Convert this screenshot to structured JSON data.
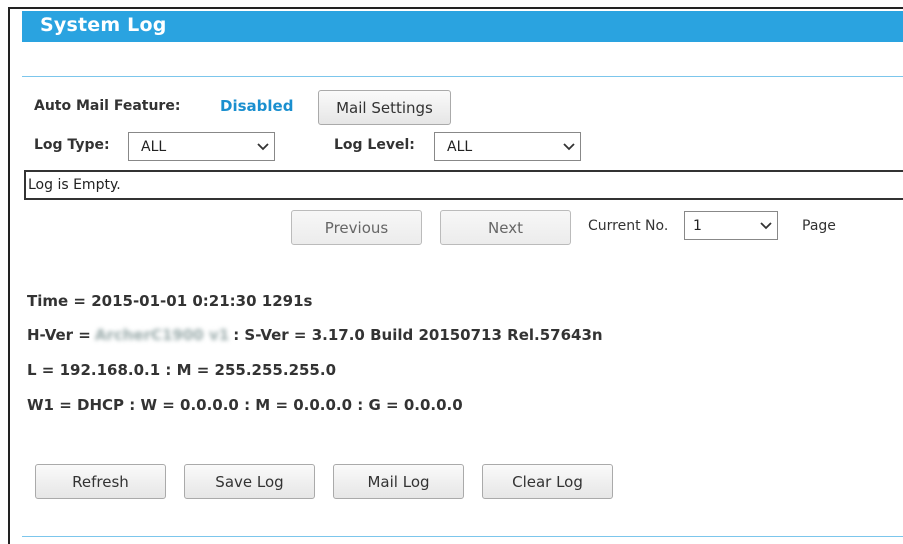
{
  "header": {
    "title": "System Log"
  },
  "controls": {
    "auto_mail_label": "Auto Mail Feature:",
    "auto_mail_status": "Disabled",
    "mail_settings_button": "Mail Settings",
    "log_type_label": "Log Type:",
    "log_type_value": "ALL",
    "log_level_label": "Log Level:",
    "log_level_value": "ALL"
  },
  "log": {
    "content": "Log is Empty."
  },
  "pagination": {
    "previous_button": "Previous",
    "next_button": "Next",
    "current_no_label": "Current No.",
    "current_no_value": "1",
    "page_label": "Page"
  },
  "info": {
    "time_line": "Time = 2015-01-01 0:21:30 1291s",
    "hver_prefix": "H-Ver =",
    "hver_value": "ArcherC1900 v1",
    "sver_text": ": S-Ver = 3.17.0 Build 20150713 Rel.57643n",
    "lan_line": "L = 192.168.0.1 : M = 255.255.255.0",
    "wan_line": "W1 = DHCP : W = 0.0.0.0 : M = 0.0.0.0 : G = 0.0.0.0"
  },
  "actions": {
    "refresh": "Refresh",
    "save_log": "Save Log",
    "mail_log": "Mail Log",
    "clear_log": "Clear Log"
  },
  "colors": {
    "accent": "#2aa3e0",
    "status_disabled": "#1a8fcf",
    "divider": "#7cc6ec"
  },
  "icons": {
    "dropdown": "chevron-down-icon"
  }
}
